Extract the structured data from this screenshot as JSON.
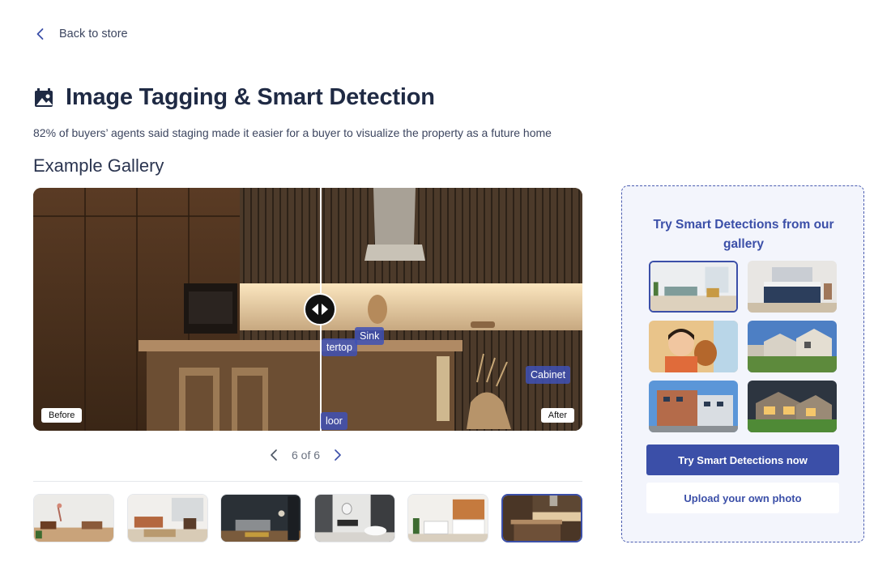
{
  "nav": {
    "back_label": "Back to store",
    "back_icon": "chevron-left-icon"
  },
  "header": {
    "icon": "image-tag-icon",
    "title": "Image Tagging & Smart Detection",
    "subtitle": "82% of buyers’ agents said staging made it easier for a buyer to visualize the property as a future home"
  },
  "gallery": {
    "heading": "Example Gallery",
    "before_label": "Before",
    "after_label": "After",
    "tags": [
      "tertop",
      "Sink",
      "Cabinet",
      "loor"
    ],
    "pager": {
      "text": "6 of 6",
      "current": 6,
      "total": 6
    },
    "thumbnails": [
      {
        "scene": "living-room-white"
      },
      {
        "scene": "living-room-loft"
      },
      {
        "scene": "living-room-dark"
      },
      {
        "scene": "bathroom"
      },
      {
        "scene": "kitchen-white"
      },
      {
        "scene": "kitchen-wood",
        "active": true
      }
    ]
  },
  "panel": {
    "heading": "Try Smart Detections from our gallery",
    "images": [
      {
        "scene": "living-room",
        "active": true
      },
      {
        "scene": "bedroom"
      },
      {
        "scene": "child-with-dog"
      },
      {
        "scene": "townhouses"
      },
      {
        "scene": "apartment-building"
      },
      {
        "scene": "house-evening"
      }
    ],
    "primary_button": "Try Smart Detections now",
    "secondary_button": "Upload your own photo"
  },
  "colors": {
    "accent": "#3b4fa8",
    "panel_bg": "#f3f5fc",
    "text_dark": "#1f2a44"
  }
}
